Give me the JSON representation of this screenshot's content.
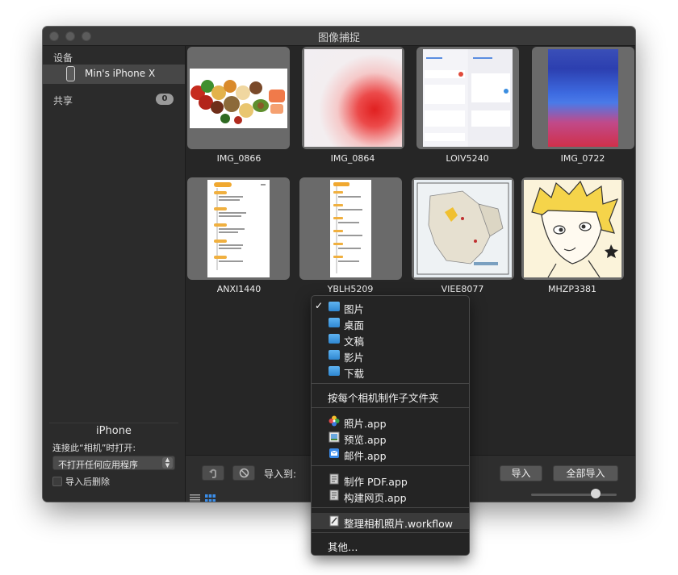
{
  "window": {
    "title": "图像捕捉"
  },
  "sidebar": {
    "devices_header": "设备",
    "device_name": "Min's iPhone X",
    "shared_header": "共享",
    "shared_count": "0",
    "panel_title": "iPhone",
    "open_label": "连接此“相机”时打开:",
    "open_app_selected": "不打开任何应用程序",
    "delete_after_import": "导入后删除"
  },
  "thumbnails": [
    {
      "name": "IMG_0866",
      "content": "food"
    },
    {
      "name": "IMG_0864",
      "content": "red-blur"
    },
    {
      "name": "LOIV5240",
      "content": "settings-screenshot"
    },
    {
      "name": "IMG_0722",
      "content": "blue-red-blur"
    },
    {
      "name": "ANXI1440",
      "content": "timeline-doc"
    },
    {
      "name": "YBLH5209",
      "content": "timeline-doc-narrow"
    },
    {
      "name": "VIEE8077",
      "content": "map"
    },
    {
      "name": "MHZP3381",
      "content": "anime-drawing"
    }
  ],
  "toolbar": {
    "import_to_label": "导入到:",
    "import_button": "导入",
    "import_all_button": "全部导入"
  },
  "dropdown": {
    "folders": [
      {
        "label": "图片",
        "checked": true,
        "icon": "pictures-folder-icon"
      },
      {
        "label": "桌面",
        "checked": false,
        "icon": "desktop-folder-icon"
      },
      {
        "label": "文稿",
        "checked": false,
        "icon": "documents-folder-icon"
      },
      {
        "label": "影片",
        "checked": false,
        "icon": "movies-folder-icon"
      },
      {
        "label": "下载",
        "checked": false,
        "icon": "downloads-folder-icon"
      }
    ],
    "subfolder_option": "按每个相机制作子文件夹",
    "apps": [
      {
        "label": "照片.app",
        "icon": "photos-app-icon"
      },
      {
        "label": "预览.app",
        "icon": "preview-app-icon"
      },
      {
        "label": "邮件.app",
        "icon": "mail-app-icon"
      }
    ],
    "automator": [
      {
        "label": "制作 PDF.app",
        "icon": "automator-icon"
      },
      {
        "label": "构建网页.app",
        "icon": "automator-icon"
      }
    ],
    "workflow": {
      "label": "整理相机照片.workflow",
      "icon": "workflow-icon"
    },
    "other": "其他…",
    "checkmark": "✓"
  }
}
